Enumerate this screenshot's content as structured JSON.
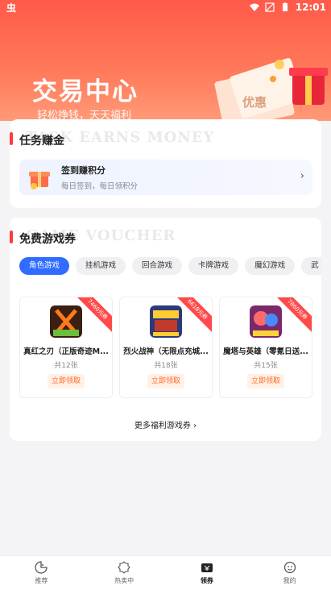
{
  "status_bar": {
    "app_glyph": "虫",
    "time": "12:01"
  },
  "hero": {
    "title": "交易中心",
    "subtitle": "轻松挣钱，天天福利",
    "deco_text": "优惠"
  },
  "task_section": {
    "watermark": "TASK EARNS MONEY",
    "title": "任务赚金",
    "checkin": {
      "title": "签到赚积分",
      "desc": "每日签到，每日领积分",
      "arrow": "›"
    }
  },
  "voucher_section": {
    "watermark": "GAME VOUCHER",
    "title": "免费游戏券",
    "tabs": [
      "角色游戏",
      "挂机游戏",
      "回合游戏",
      "卡牌游戏",
      "魔幻游戏",
      "武"
    ],
    "games": [
      {
        "ribbon": "7460元券",
        "name": "真红之刃（正版奇迹M...",
        "count": "共12张",
        "claim": "立即领取"
      },
      {
        "ribbon": "6618元券",
        "name": "烈火战神（无限点充城...",
        "count": "共18张",
        "claim": "立即领取"
      },
      {
        "ribbon": "7860元券",
        "name": "魔塔与英雄（零氪日送...",
        "count": "共15张",
        "claim": "立即领取"
      }
    ],
    "more": "更多福利游戏券 ›"
  },
  "bottom_nav": [
    {
      "label": "推荐",
      "icon": "recommend-icon",
      "active": false
    },
    {
      "label": "热卖中",
      "icon": "hot-sale-icon",
      "active": false
    },
    {
      "label": "领券",
      "icon": "coupon-icon",
      "active": true
    },
    {
      "label": "我的",
      "icon": "profile-icon",
      "active": false
    }
  ]
}
